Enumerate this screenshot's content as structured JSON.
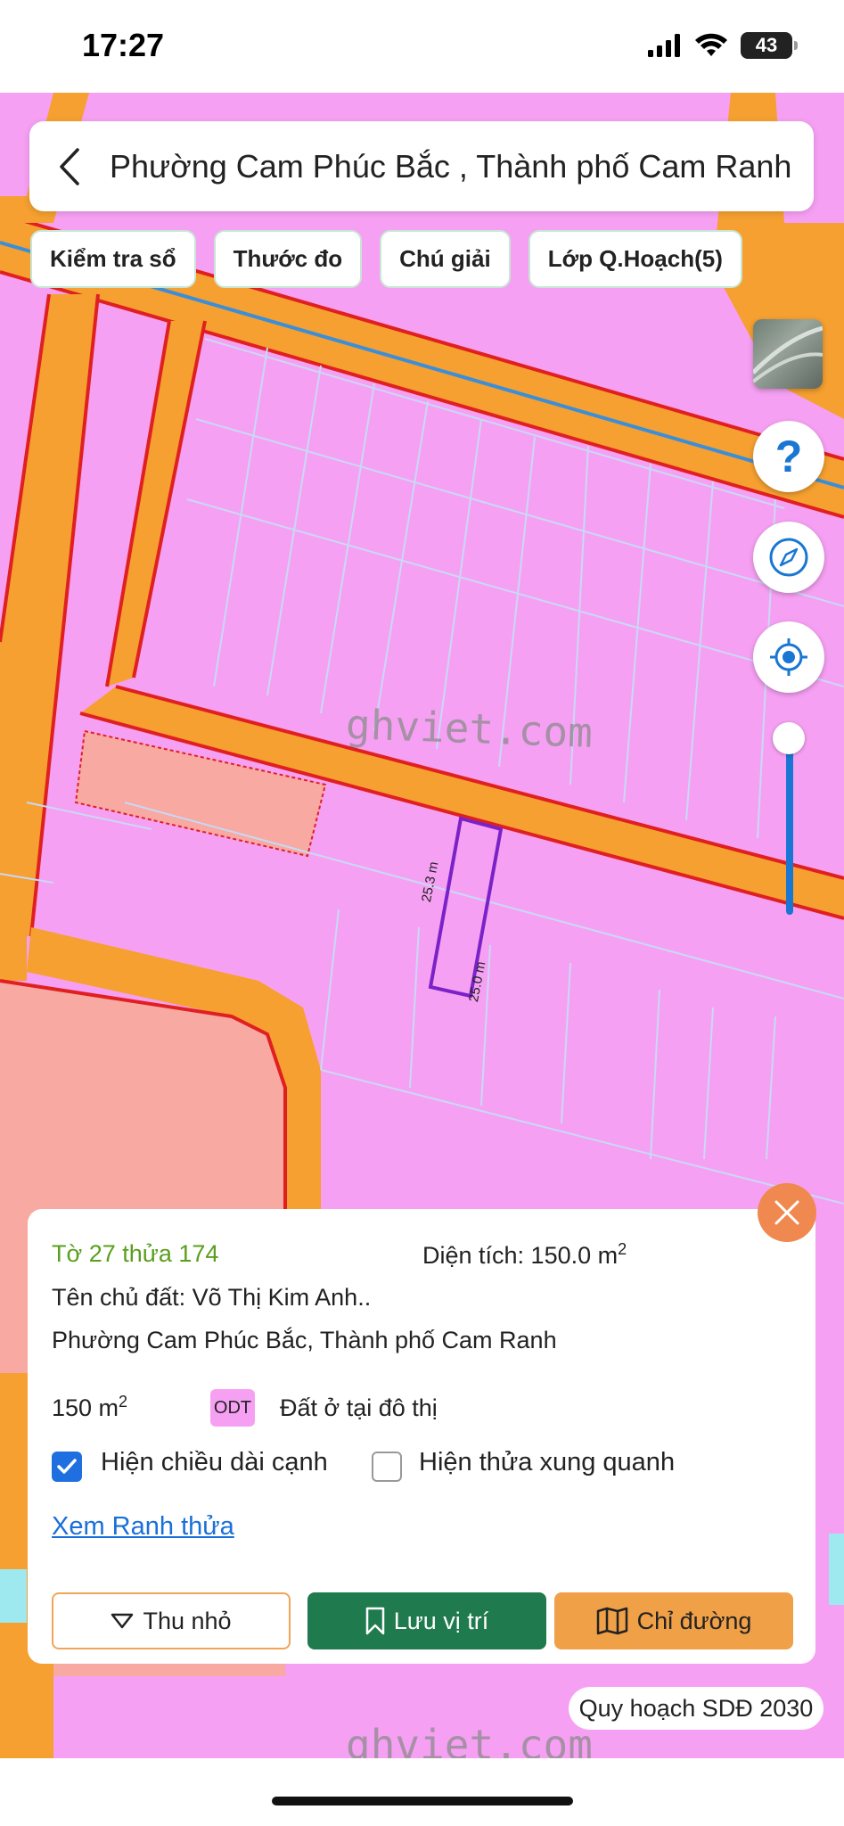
{
  "status_bar": {
    "time": "17:27",
    "battery": "43"
  },
  "map": {
    "watermark": "ghviet.com",
    "edge_labels": [
      "25.3 m",
      "25.0 m"
    ],
    "colors": {
      "residential": "#f6a0f3",
      "road": "#f5a030",
      "public": "#f7a9a2",
      "parcel_lines": "#c9d8f5",
      "selected_parcel": "#7a22c8",
      "boundary": "#e02020",
      "railway": "#3b8ed8"
    }
  },
  "search": {
    "title": "Phường Cam Phúc Bắc , Thành phố Cam Ranh"
  },
  "chips": [
    {
      "label": "Kiểm tra sổ"
    },
    {
      "label": "Thước đo"
    },
    {
      "label": "Chú giải"
    },
    {
      "label": "Lớp Q.Hoạch(5)"
    }
  ],
  "panel": {
    "sheet_parcel": "Tờ 27 thửa 174",
    "area_label": "Diện tích: 150.0 m",
    "area_sup": "2",
    "owner": "Tên chủ đất: Võ Thị Kim Anh..",
    "address": "Phường Cam Phúc Bắc, Thành phố Cam Ranh",
    "land_area": "150 m",
    "land_area_sup": "2",
    "land_code": "ODT",
    "land_type": "Đất ở tại đô thị",
    "show_edges_label": "Hiện chiều dài cạnh",
    "show_edges_checked": true,
    "show_neighbors_label": "Hiện thửa xung quanh",
    "show_neighbors_checked": false,
    "view_boundary_link": "Xem Ranh thửa",
    "buttons": {
      "minimize": "Thu nhỏ",
      "save_location": "Lưu vị trí",
      "directions": "Chỉ đường"
    }
  },
  "plan_badge": "Quy hoạch SDĐ 2030",
  "accent_colors": {
    "close": "#f0894f",
    "save": "#1f7a4d",
    "directions": "#f0a046",
    "zoom": "#1976d2"
  }
}
